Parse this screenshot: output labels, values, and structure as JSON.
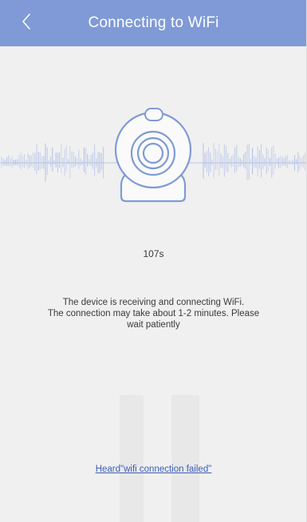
{
  "header": {
    "title": "Connecting to WiFi",
    "back_icon": "chevron-left-icon"
  },
  "countdown": {
    "text": "107s"
  },
  "message": {
    "line1": "The device is receiving and connecting WiFi.",
    "line2": "The connection may take about 1-2 minutes. Please",
    "line3": "wait patiently"
  },
  "link": {
    "text": "Heard\"wifi connection failed\""
  },
  "illustration": {
    "icon": "webcam-icon",
    "wave_icon": "sound-wave-icon"
  },
  "colors": {
    "header_bg": "#7f9ad6",
    "accent": "#7f9ad6",
    "link": "#3a5db8"
  }
}
